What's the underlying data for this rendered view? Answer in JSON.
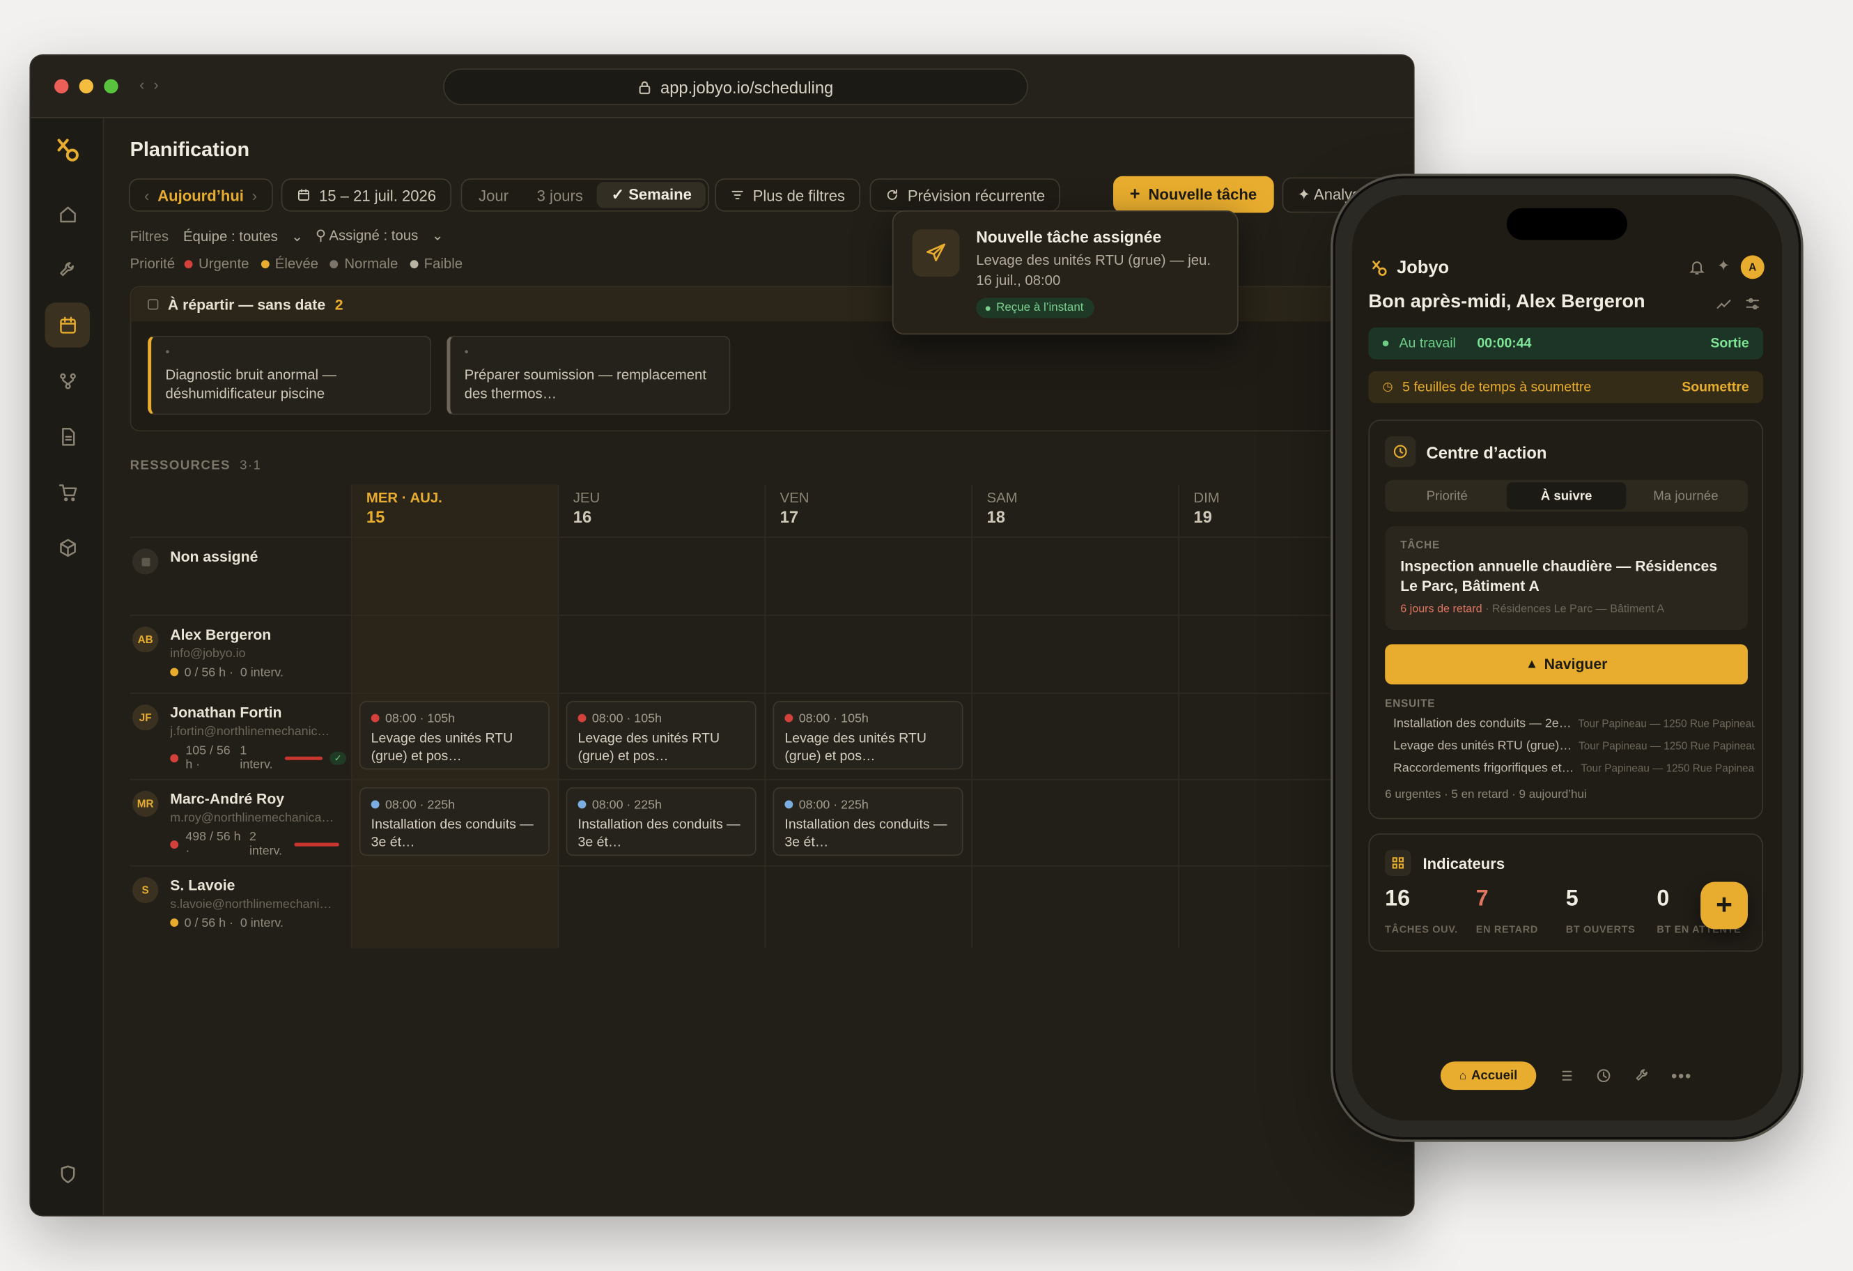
{
  "browser": {
    "url": "app.jobyo.io/scheduling"
  },
  "page": {
    "title": "Planification"
  },
  "toolbar": {
    "today": "Aujourd’hui",
    "range": "15 – 21 juil. 2026",
    "views": [
      "Jour",
      "3 jours",
      "✓ Semaine"
    ],
    "more_filters": "Plus de filtres",
    "recurring": "Prévision récurrente",
    "new_task": "Nouvelle tâche",
    "analysis": "✦ Analys"
  },
  "filters": {
    "label": "Filtres",
    "team": "Équipe : toutes",
    "assigned": "Assigné : tous",
    "priority_label": "Priorité",
    "priorities": [
      {
        "label": "Urgente",
        "color": "#d4403a"
      },
      {
        "label": "Élevée",
        "color": "#e8ad2e"
      },
      {
        "label": "Normale",
        "color": "#7c766a"
      },
      {
        "label": "Faible",
        "color": "#b9b3a6"
      }
    ]
  },
  "unscheduled": {
    "title": "À répartir — sans date",
    "count": "2",
    "cards": [
      "Diagnostic bruit anormal — déshumidificateur piscine",
      "Préparer soumission — remplacement des thermos…"
    ]
  },
  "resources": {
    "label": "RESSOURCES",
    "count": "3·1"
  },
  "days": [
    {
      "name": "MER · AUJ.",
      "num": "15"
    },
    {
      "name": "JEU",
      "num": "16"
    },
    {
      "name": "VEN",
      "num": "17"
    },
    {
      "name": "SAM",
      "num": "18"
    },
    {
      "name": "DIM",
      "num": "19"
    }
  ],
  "people": [
    {
      "initials": "",
      "name": "Non assigné",
      "email": "",
      "stats": ""
    },
    {
      "initials": "AB",
      "name": "Alex Bergeron",
      "email": "info@jobyo.io",
      "hours": "0 / 56 h ·",
      "interv": "0 interv."
    },
    {
      "initials": "JF",
      "name": "Jonathan Fortin",
      "email": "j.fortin@northlinemechanical…",
      "hours": "105 / 56 h ·",
      "interv": "1 interv."
    },
    {
      "initials": "MR",
      "name": "Marc-André Roy",
      "email": "m.roy@northlinemechanical…",
      "hours": "498 / 56 h ·",
      "interv": "2 interv."
    },
    {
      "initials": "S",
      "name": "S. Lavoie",
      "email": "s.lavoie@northlinemechanic…",
      "hours": "0 / 56 h ·",
      "interv": "0 interv."
    }
  ],
  "events": {
    "jf": {
      "time": "08:00 · 105h",
      "title": "Levage des unités RTU (grue) et pos…"
    },
    "mr": {
      "time": "08:00 · 225h",
      "title": "Installation des conduits — 3e ét…"
    }
  },
  "toast": {
    "title": "Nouvelle tâche assignée",
    "body": "Levage des unités RTU (grue) — jeu. 16 juil., 08:00",
    "badge": "Reçue à l’instant"
  },
  "mobile": {
    "app_name": "Jobyo",
    "avatar": "A",
    "greeting": "Bon après-midi, Alex Bergeron",
    "work": {
      "status": "Au travail",
      "timer": "00:00:44",
      "action": "Sortie"
    },
    "timesheets": {
      "text": "5 feuilles de temps à soumettre",
      "action": "Soumettre"
    },
    "action_center": {
      "title": "Centre d’action",
      "tabs": [
        "Priorité",
        "À suivre",
        "Ma journée"
      ],
      "task_label": "TÂCHE",
      "task_title": "Inspection annuelle chaudière — Résidences Le Parc, Bâtiment A",
      "task_late": "6 jours de retard",
      "task_loc": "· Résidences Le Parc — Bâtiment A",
      "navigate": "Naviguer",
      "next_label": "ENSUITE",
      "next": [
        {
          "title": "Installation des conduits — 2e…",
          "loc": "Tour Papineau — 1250 Rue Papineau"
        },
        {
          "title": "Levage des unités RTU (grue)…",
          "loc": "Tour Papineau — 1250 Rue Papineau"
        },
        {
          "title": "Raccordements frigorifiques et…",
          "loc": "Tour Papineau — 1250 Rue Papineau"
        }
      ],
      "summary": "6 urgentes · 5 en retard · 9 aujourd’hui"
    },
    "indicators": {
      "title": "Indicateurs",
      "items": [
        {
          "value": "16",
          "label": "TÂCHES OUV."
        },
        {
          "value": "7",
          "label": "EN RETARD"
        },
        {
          "value": "5",
          "label": "BT OUVERTS"
        },
        {
          "value": "0",
          "label": "BT EN ATTENTE"
        }
      ]
    },
    "tabbar": {
      "home": "Accueil"
    }
  }
}
